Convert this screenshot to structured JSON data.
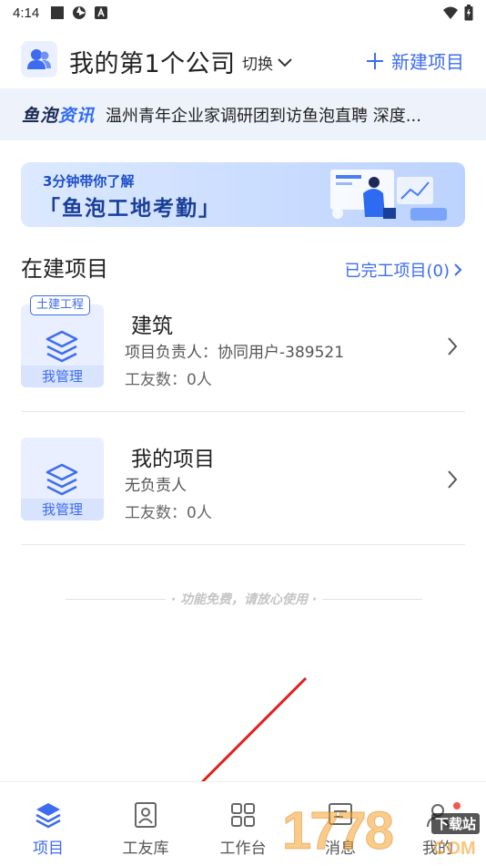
{
  "status_bar": {
    "time": "4:14"
  },
  "header": {
    "company_name": "我的第1个公司",
    "switch_label": "切换",
    "new_project_label": "新建项目"
  },
  "news": {
    "brand_main": "鱼泡",
    "brand_accent": "资讯",
    "headline": "温州青年企业家调研团到访鱼泡直聘 深度..."
  },
  "banner": {
    "line1": "3分钟带你了解",
    "line2": "「鱼泡工地考勤」"
  },
  "section": {
    "title": "在建项目",
    "completed_link": "已完工项目(0)"
  },
  "projects": [
    {
      "tag": "土建工程",
      "manage_label": "我管理",
      "name": "建筑",
      "leader": "项目负责人：协同用户-389521",
      "workers": "工友数：0人"
    },
    {
      "tag": "",
      "manage_label": "我管理",
      "name": "我的项目",
      "leader": "无负责人",
      "workers": "工友数：0人"
    }
  ],
  "free_note": "· 功能免费，请放心使用 ·",
  "tabs": [
    {
      "label": "项目",
      "icon": "layers-icon",
      "active": true
    },
    {
      "label": "工友库",
      "icon": "contacts-book-icon",
      "active": false
    },
    {
      "label": "工作台",
      "icon": "grid-icon",
      "active": false
    },
    {
      "label": "消息",
      "icon": "message-icon",
      "active": false
    },
    {
      "label": "我的",
      "icon": "profile-icon",
      "active": false
    }
  ],
  "watermark": {
    "text": "1778",
    "subtext": "下载站",
    "domain": "COM"
  },
  "colors": {
    "accent": "#3d6cf0",
    "news_bg": "#edf2fb",
    "badge": "#f05a4a",
    "arrow": "#e0201a"
  }
}
